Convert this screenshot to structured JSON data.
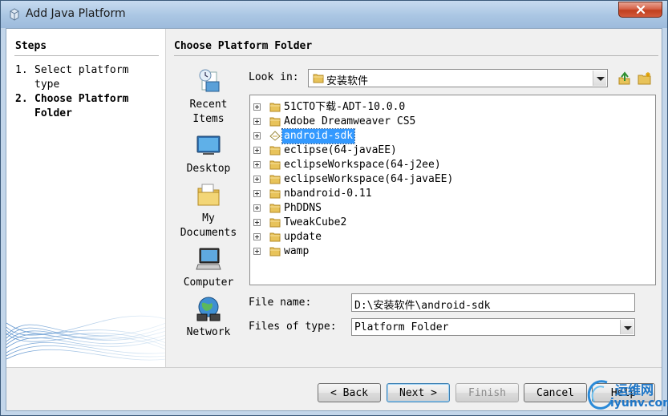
{
  "window": {
    "title": "Add Java Platform"
  },
  "steps": {
    "title": "Steps",
    "items": [
      {
        "num": "1.",
        "label": "Select platform type"
      },
      {
        "num": "2.",
        "label": "Choose Platform Folder"
      }
    ]
  },
  "main": {
    "title": "Choose Platform Folder"
  },
  "places": [
    {
      "label": "Recent Items",
      "icon": "recent-items-icon"
    },
    {
      "label": "Desktop",
      "icon": "desktop-icon"
    },
    {
      "label": "My Documents",
      "icon": "my-documents-icon"
    },
    {
      "label": "Computer",
      "icon": "computer-icon"
    },
    {
      "label": "Network",
      "icon": "network-icon"
    }
  ],
  "lookin": {
    "label": "Look in:",
    "value": "安装软件"
  },
  "files": [
    {
      "name": "51CTO下载-ADT-10.0.0",
      "selected": false
    },
    {
      "name": "Adobe Dreamweaver CS5",
      "selected": false
    },
    {
      "name": "android-sdk",
      "selected": true
    },
    {
      "name": "eclipse(64-javaEE)",
      "selected": false
    },
    {
      "name": "eclipseWorkspace(64-j2ee)",
      "selected": false
    },
    {
      "name": "eclipseWorkspace(64-javaEE)",
      "selected": false
    },
    {
      "name": "nbandroid-0.11",
      "selected": false
    },
    {
      "name": "PhDDNS",
      "selected": false
    },
    {
      "name": "TweakCube2",
      "selected": false
    },
    {
      "name": "update",
      "selected": false
    },
    {
      "name": "wamp",
      "selected": false
    }
  ],
  "file_name": {
    "label": "File name:",
    "value": "D:\\安装软件\\android-sdk"
  },
  "file_type": {
    "label": "Files of type:",
    "value": "Platform Folder"
  },
  "buttons": {
    "back": "< Back",
    "next": "Next >",
    "finish": "Finish",
    "cancel": "Cancel",
    "help": "Help"
  },
  "watermark": {
    "cn": "运维网",
    "url": "iyunv.com"
  },
  "colors": {
    "selection": "#3399ff",
    "folder": "#e8c35a",
    "accent": "#3c7fb1"
  }
}
